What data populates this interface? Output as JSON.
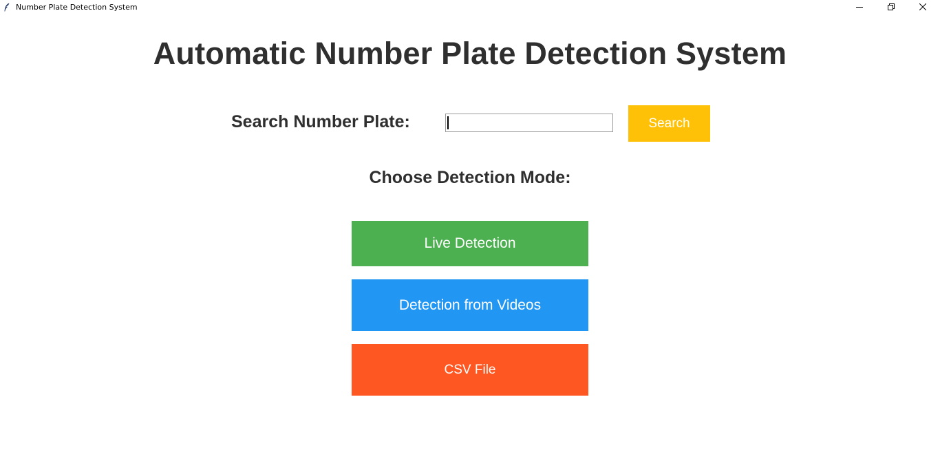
{
  "window": {
    "title": "Number Plate Detection System",
    "app_icon": "feather-icon",
    "controls": {
      "minimize": "minimize-icon",
      "maximize": "restore-icon",
      "close": "close-icon"
    }
  },
  "main": {
    "heading": "Automatic Number Plate Detection System",
    "search": {
      "label": "Search Number Plate:",
      "value": "",
      "button_label": "Search"
    },
    "mode_label": "Choose Detection Mode:",
    "modes": [
      {
        "label": "Live Detection"
      },
      {
        "label": "Detection from Videos"
      },
      {
        "label": "CSV File"
      }
    ]
  },
  "colors": {
    "search_button": "#ffc107",
    "live_button": "#4caf50",
    "videos_button": "#2196f3",
    "csv_button": "#ff5722",
    "text": "#2f2f2f"
  }
}
